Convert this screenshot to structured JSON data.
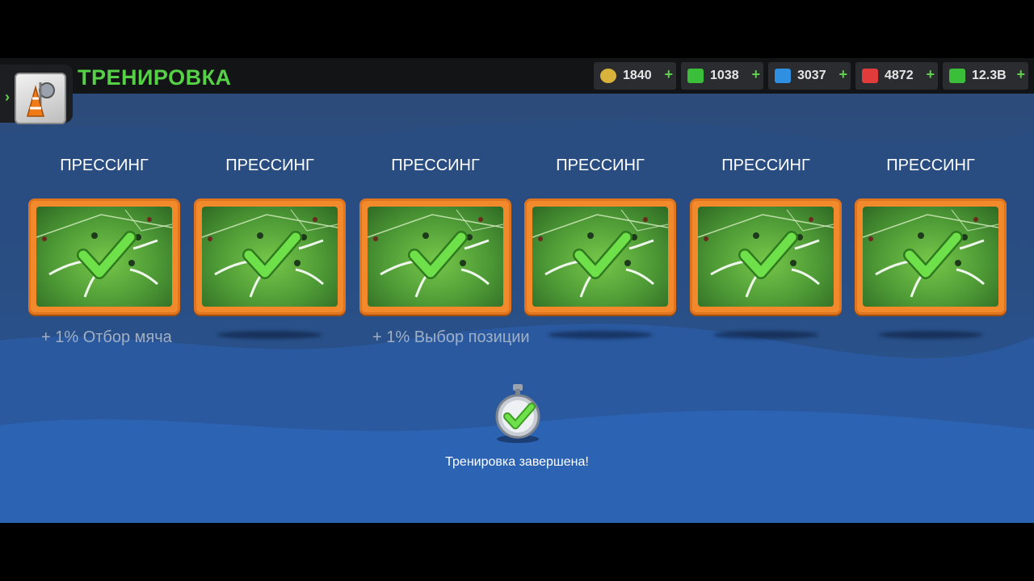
{
  "header": {
    "title": "ТРЕНИРОВКА",
    "menu_icon": "training-cone-icon"
  },
  "currencies": [
    {
      "icon": "token-icon",
      "value": "1840",
      "add": "+",
      "color": "#d8b23a"
    },
    {
      "icon": "cash-icon",
      "value": "1038",
      "add": "+",
      "color": "#3bbf3b"
    },
    {
      "icon": "energy-icon",
      "value": "3037",
      "add": "+",
      "color": "#2f8fe0"
    },
    {
      "icon": "health-icon",
      "value": "4872",
      "add": "+",
      "color": "#e23b3b"
    },
    {
      "icon": "money-icon",
      "value": "12.3B",
      "add": "+",
      "color": "#3bbf3b"
    }
  ],
  "drills": [
    {
      "title": "ПРЕССИНГ",
      "bonus": "+ 1% Отбор мяча"
    },
    {
      "title": "ПРЕССИНГ",
      "bonus": ""
    },
    {
      "title": "ПРЕССИНГ",
      "bonus": "+ 1% Выбор позиции"
    },
    {
      "title": "ПРЕССИНГ",
      "bonus": ""
    },
    {
      "title": "ПРЕССИНГ",
      "bonus": ""
    },
    {
      "title": "ПРЕССИНГ",
      "bonus": ""
    }
  ],
  "status": {
    "icon": "stopwatch-check-icon",
    "text": "Тренировка завершена!"
  }
}
